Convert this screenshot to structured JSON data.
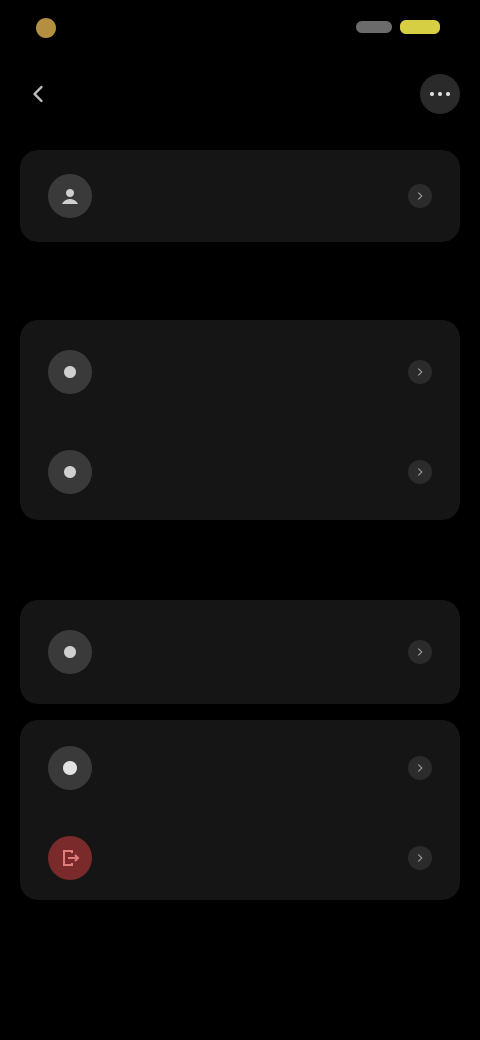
{
  "status_bar": {
    "time": "",
    "battery_color": "#d6cf43"
  },
  "header": {
    "title": "",
    "more_icon": "more-icon"
  },
  "profile_card": {
    "label": ""
  },
  "section_1": {
    "title": "",
    "items": [
      {
        "label": "",
        "sublabel": ""
      },
      {
        "label": ""
      }
    ]
  },
  "section_2": {
    "title": "",
    "items": [
      {
        "label": ""
      }
    ]
  },
  "section_3": {
    "items": [
      {
        "label": ""
      },
      {
        "label": ""
      }
    ]
  },
  "footer": {
    "link": ""
  },
  "colors": {
    "background": "#000000",
    "card": "#151515",
    "danger": "#d9534f"
  }
}
